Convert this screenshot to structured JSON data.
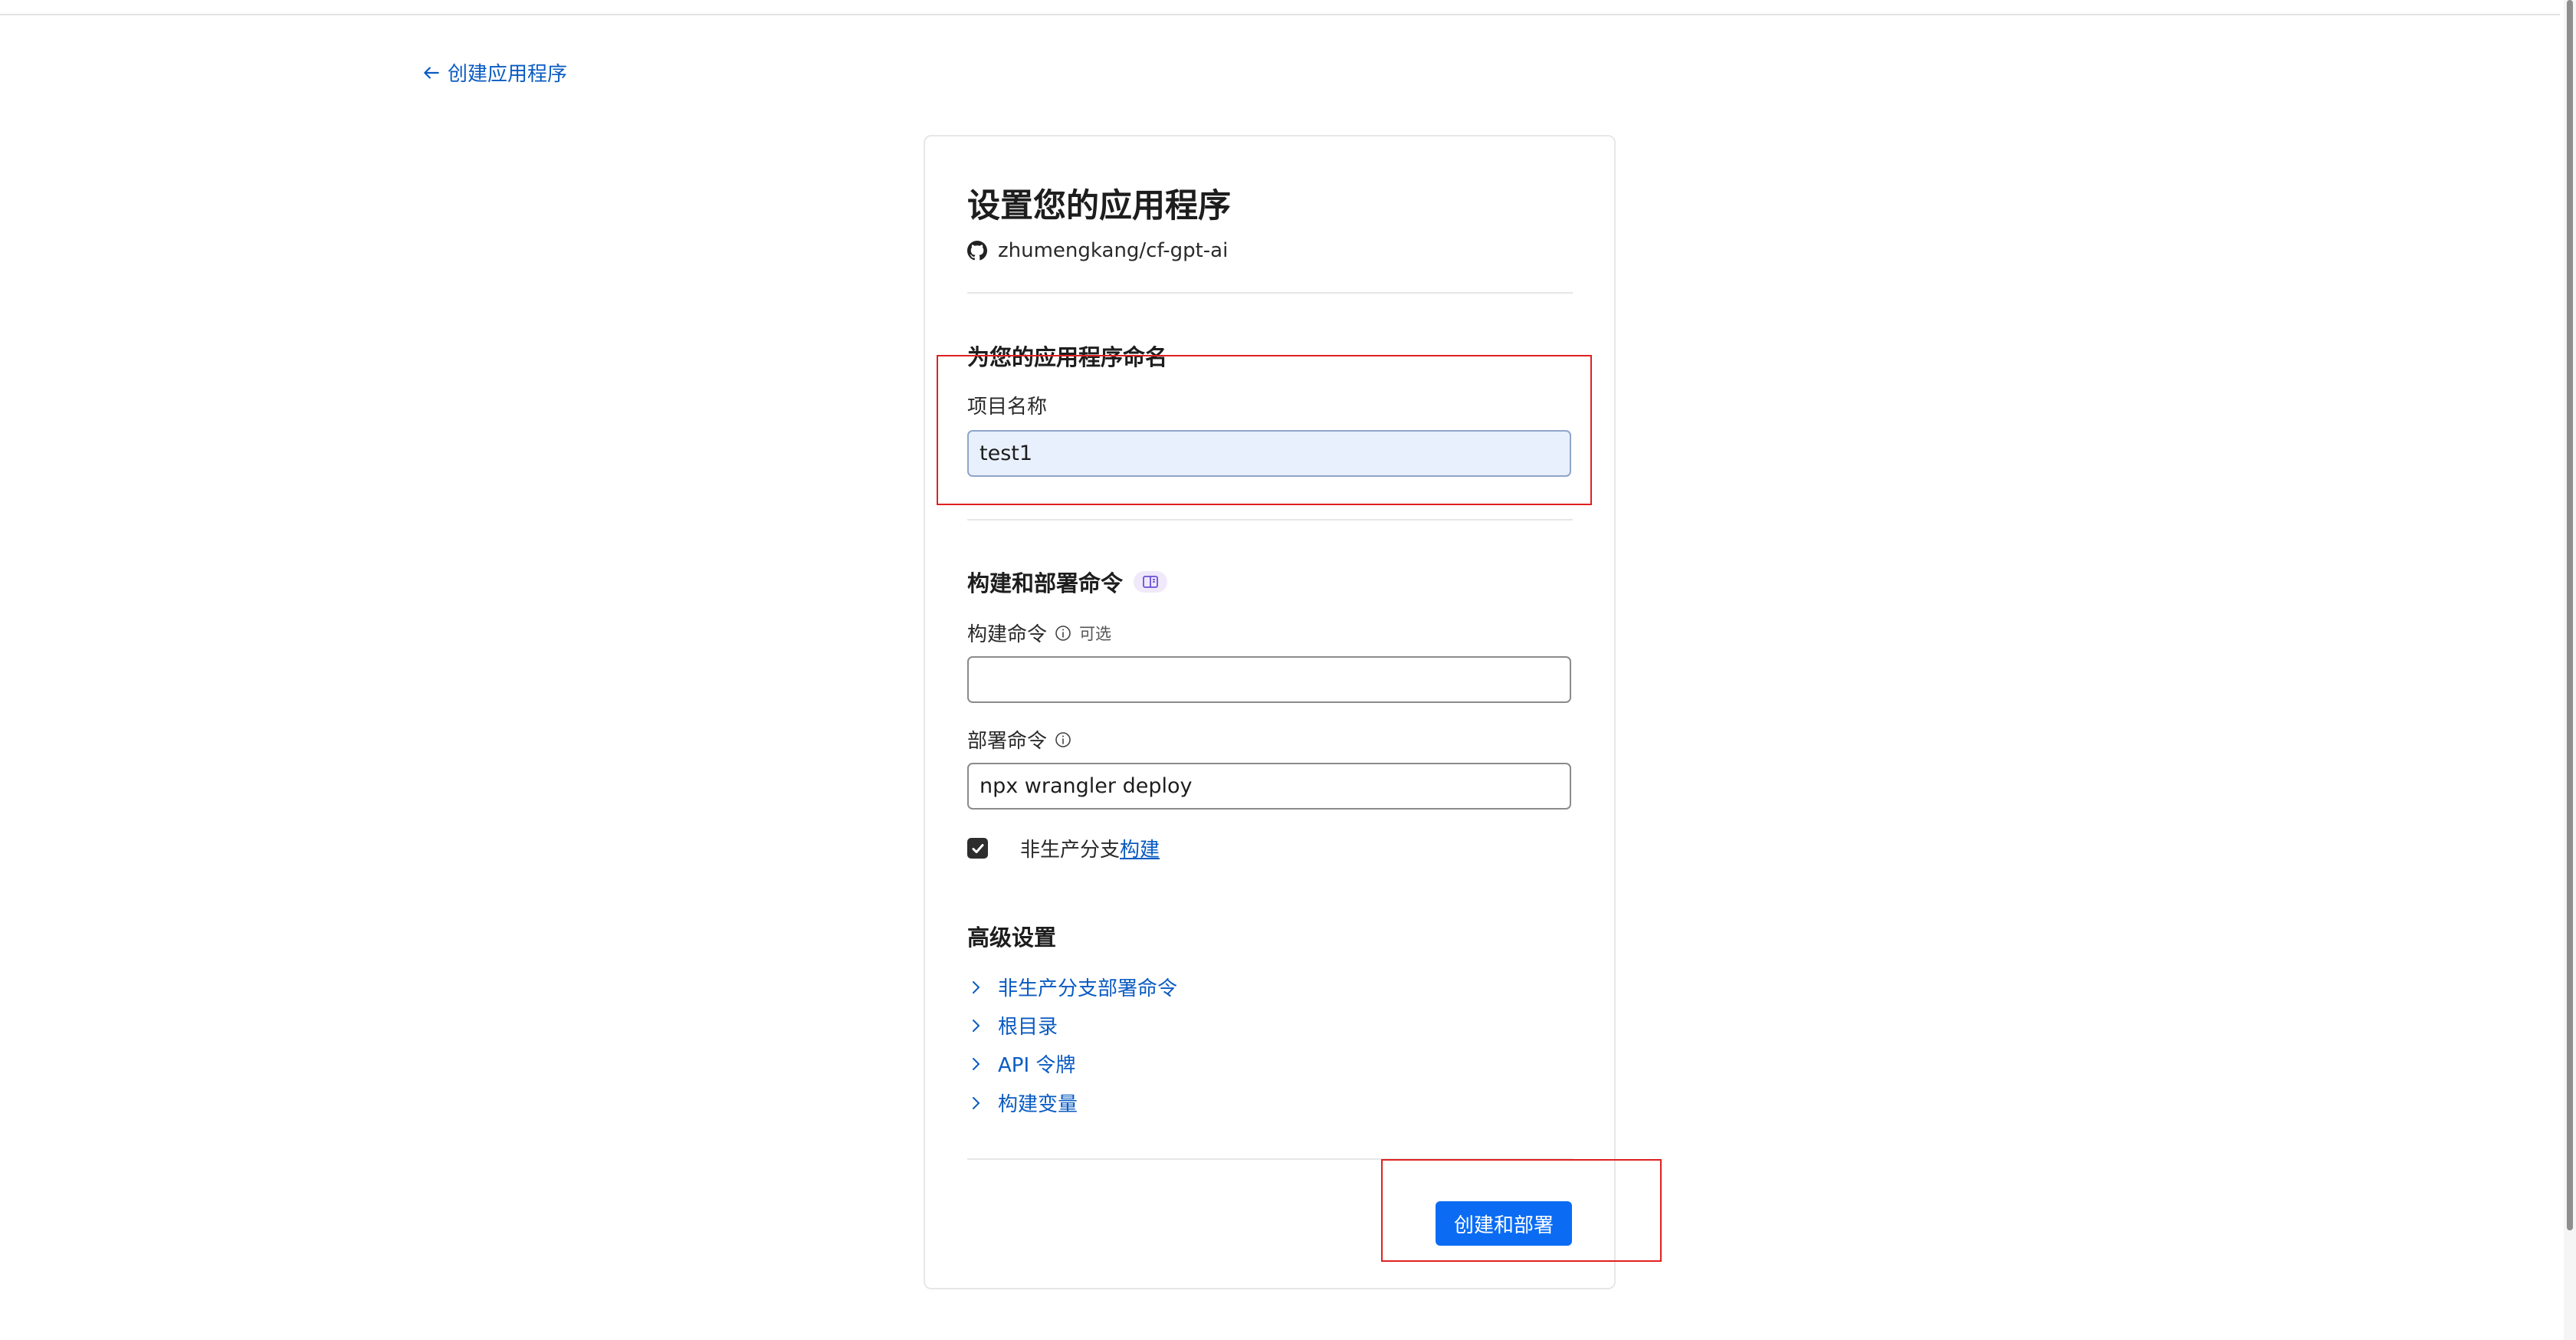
{
  "nav": {
    "back_label": "创建应用程序"
  },
  "setup": {
    "title": "设置您的应用程序",
    "repo": "zhumengkang/cf-gpt-ai"
  },
  "naming": {
    "heading": "为您的应用程序命名",
    "project_label": "项目名称",
    "project_value": "test1"
  },
  "build": {
    "heading": "构建和部署命令",
    "build_label": "构建命令",
    "build_optional": "可选",
    "build_value": "",
    "deploy_label": "部署命令",
    "deploy_value": "npx wrangler deploy",
    "nonprod_prefix": "非生产分支",
    "nonprod_link": "构建",
    "nonprod_checked": true
  },
  "advanced": {
    "heading": "高级设置",
    "items": [
      {
        "label": "非生产分支部署命令",
        "icon": "chevron-right-icon"
      },
      {
        "label": "根目录",
        "icon": "chevron-right-icon"
      },
      {
        "label": "API 令牌",
        "icon": "chevron-right-icon"
      },
      {
        "label": "构建变量",
        "icon": "chevron-right-icon"
      }
    ]
  },
  "actions": {
    "submit_label": "创建和部署"
  },
  "colors": {
    "accent": "#0b6cf3",
    "link": "#0a5bc2",
    "highlight": "#e02020",
    "autofill": "#e8f0fe"
  }
}
